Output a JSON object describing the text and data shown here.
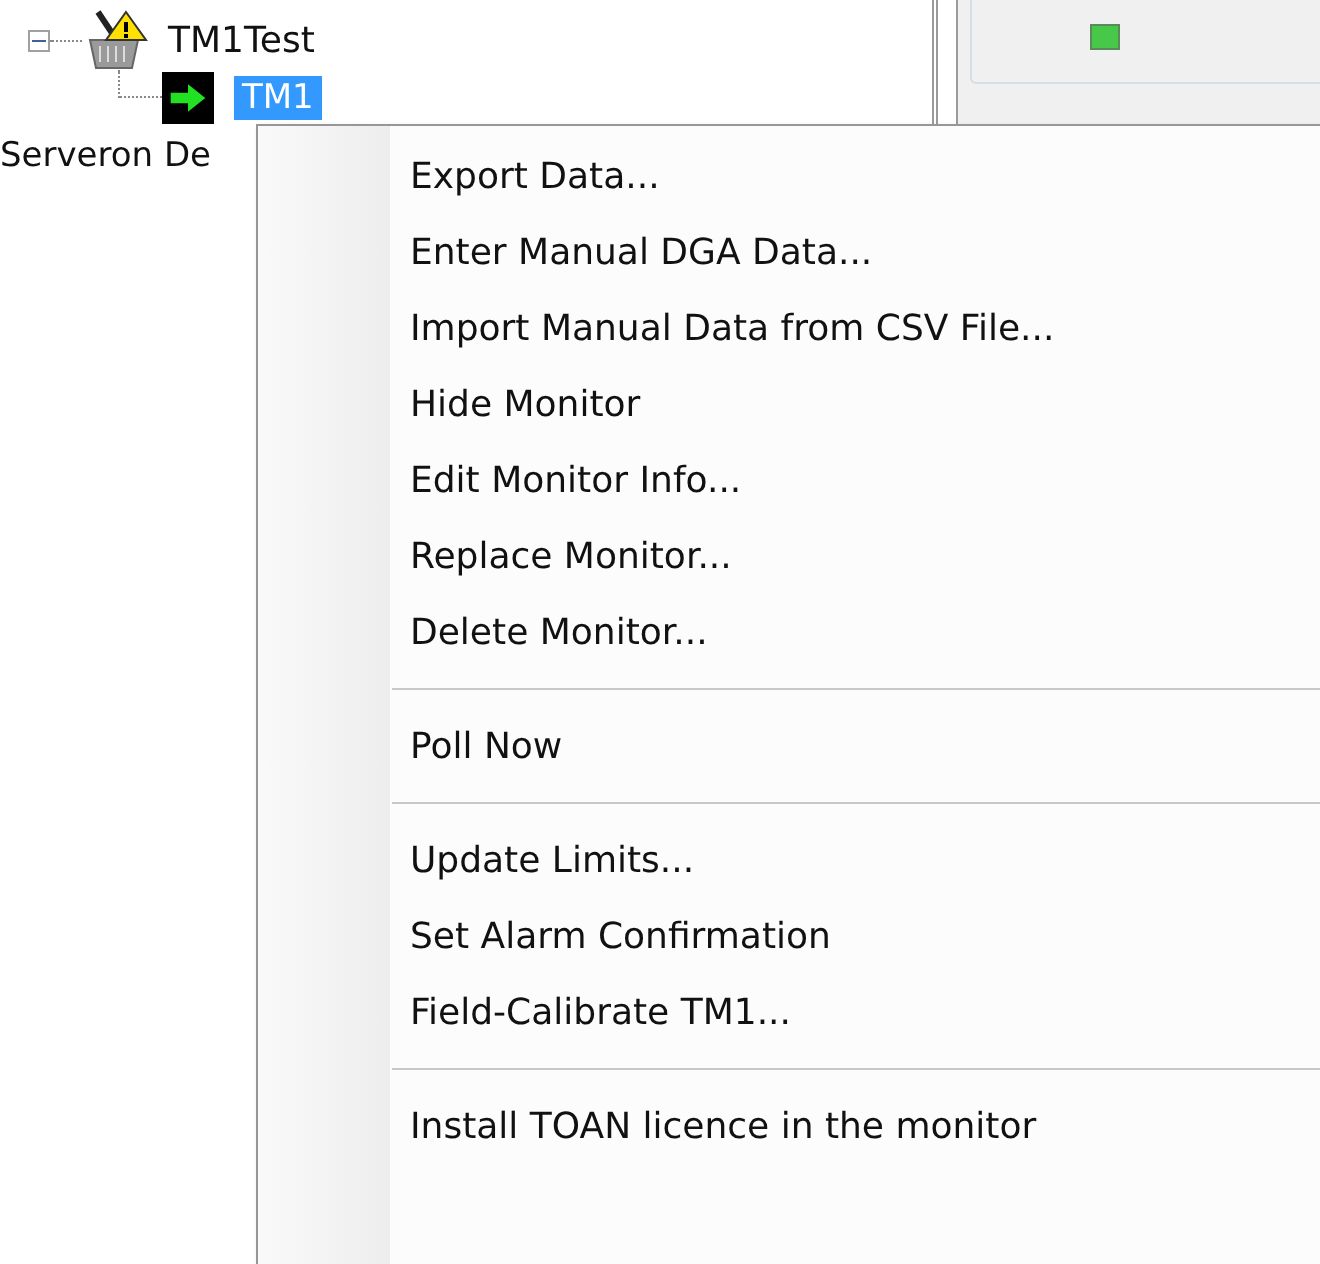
{
  "tree": {
    "items": [
      {
        "label": "TM1Test",
        "expanded": true,
        "children": [
          {
            "label": "TM1",
            "selected": true
          }
        ]
      }
    ]
  },
  "tree_footer": "Serveron De",
  "context_menu": {
    "items": [
      {
        "kind": "item",
        "label": "Export Data..."
      },
      {
        "kind": "item",
        "label": "Enter Manual DGA Data..."
      },
      {
        "kind": "item",
        "label": "Import Manual Data from CSV File..."
      },
      {
        "kind": "item",
        "label": "Hide Monitor"
      },
      {
        "kind": "item",
        "label": "Edit Monitor Info..."
      },
      {
        "kind": "item",
        "label": "Replace Monitor..."
      },
      {
        "kind": "item",
        "label": "Delete Monitor..."
      },
      {
        "kind": "separator"
      },
      {
        "kind": "item",
        "label": "Poll Now"
      },
      {
        "kind": "separator"
      },
      {
        "kind": "item",
        "label": "Update Limits..."
      },
      {
        "kind": "item",
        "label": "Set Alarm Confirmation"
      },
      {
        "kind": "item",
        "label": "Field-Calibrate TM1..."
      },
      {
        "kind": "separator"
      },
      {
        "kind": "item",
        "label": "Install TOAN licence in the monitor"
      }
    ]
  }
}
